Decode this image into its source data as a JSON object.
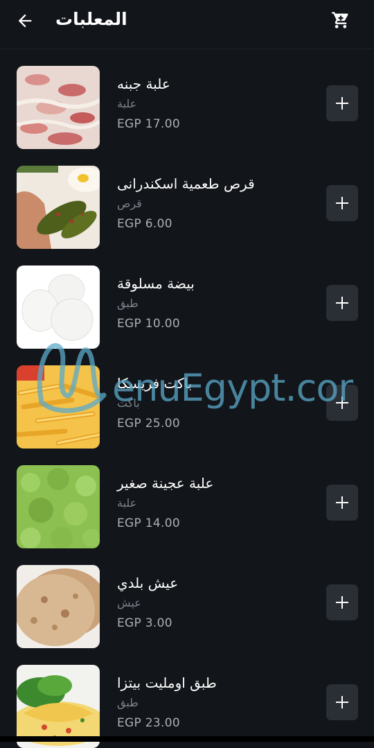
{
  "header": {
    "title": "المعلبات",
    "back_icon": "arrow-left-icon",
    "cart_icon": "cart-icon"
  },
  "items": [
    {
      "name": "علبة جبنه",
      "unit": "علبة",
      "price": "EGP 17.00",
      "image": "cheese-tub"
    },
    {
      "name": "قرص طعمية اسكندرانى",
      "unit": "قرص",
      "price": "EGP 6.00",
      "image": "falafel"
    },
    {
      "name": "بيضة مسلوقة",
      "unit": "طبق",
      "price": "EGP 10.00",
      "image": "boiled-eggs"
    },
    {
      "name": "باكت فريسكا",
      "unit": "باكت",
      "price": "EGP 25.00",
      "image": "fries"
    },
    {
      "name": "علبة عجينة صغير",
      "unit": "علبة",
      "price": "EGP 14.00",
      "image": "green-paste"
    },
    {
      "name": "عيش بلدي",
      "unit": "عيش",
      "price": "EGP 3.00",
      "image": "baladi-bread"
    },
    {
      "name": "طبق اومليت بيتزا",
      "unit": "طبق",
      "price": "EGP 23.00",
      "image": "pizza-omelette"
    }
  ],
  "add_icon": "plus-icon",
  "watermark_text": "MenuEgypt.com",
  "colors": {
    "background": "#12151a",
    "add_button": "#2a2f36",
    "secondary_text": "#7d848d",
    "price_text": "#aab0b7",
    "watermark": "#5aa9c9"
  }
}
